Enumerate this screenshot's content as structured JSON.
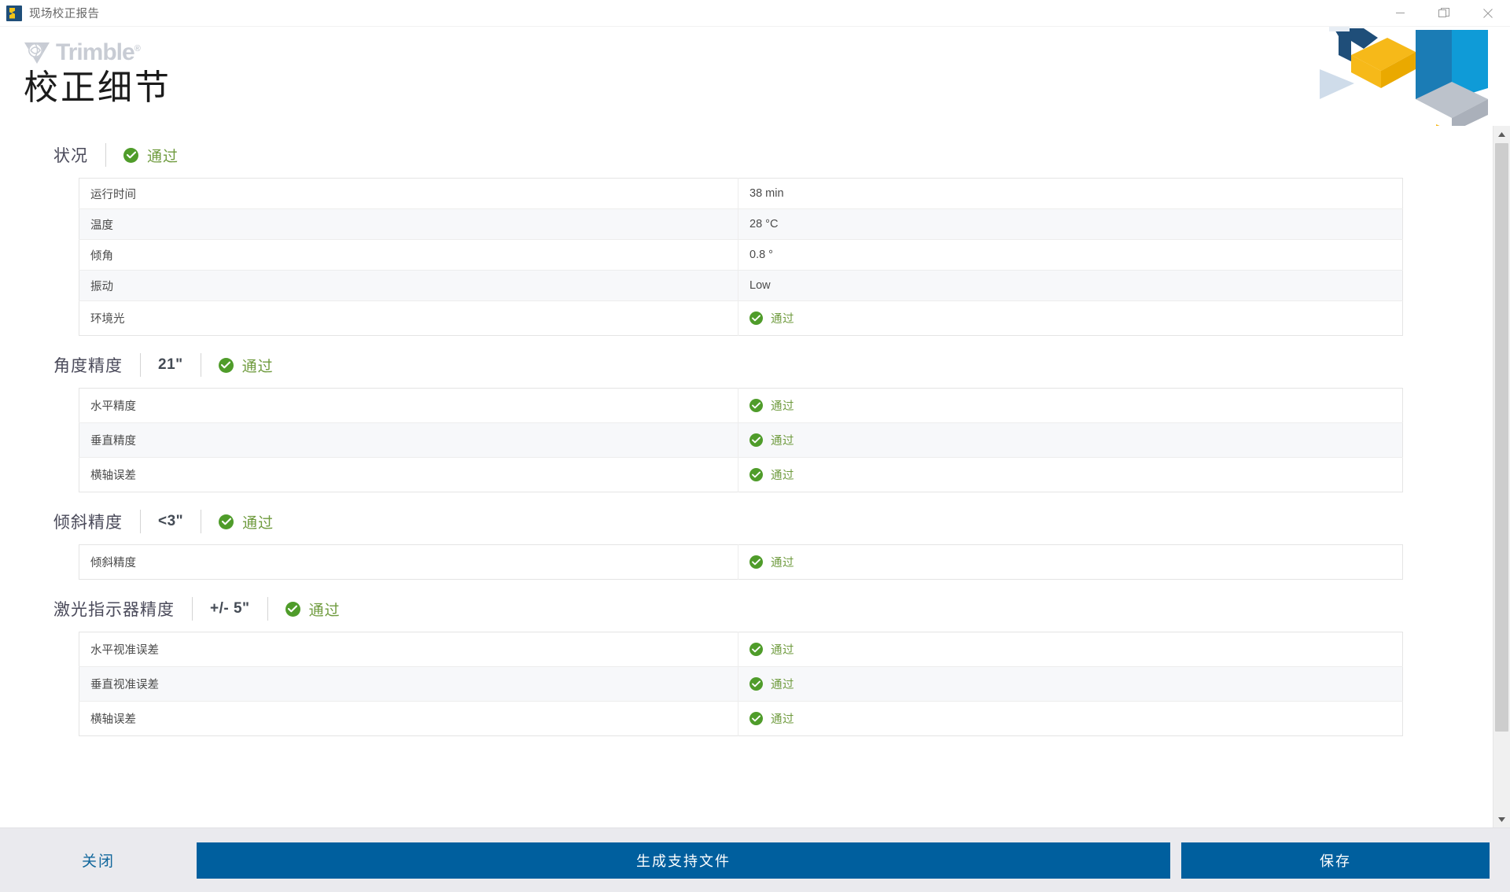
{
  "window": {
    "title": "现场校正报告",
    "icon": "trimble-app-icon",
    "controls": [
      {
        "name": "minimize-button",
        "glyph": "minimize-icon"
      },
      {
        "name": "restore-button",
        "glyph": "restore-icon"
      },
      {
        "name": "close-button",
        "glyph": "close-icon"
      }
    ]
  },
  "header": {
    "brand": "Trimble",
    "brand_mark": "trimble-globe-logo",
    "trademark": "®",
    "page_title": "校正细节",
    "decoration": "isometric-cubes-graphic",
    "colors": {
      "yellow": "#f6b919",
      "blue_dark": "#1f5c8b",
      "blue_mid": "#1b7cb5",
      "blue_light": "#0f9bd7",
      "gray": "#bcc2cb",
      "pale_blue": "#cfdcea"
    }
  },
  "status_label_pass": "通过",
  "sections": [
    {
      "title": "状况",
      "value": "",
      "status": "通过",
      "rows": [
        {
          "label": "运行时间",
          "value": "38 min",
          "status": null
        },
        {
          "label": "温度",
          "value": "28 °C",
          "status": null
        },
        {
          "label": "倾角",
          "value": "0.8 °",
          "status": null
        },
        {
          "label": "振动",
          "value": "Low",
          "status": null
        },
        {
          "label": "环境光",
          "value": "",
          "status": "通过"
        }
      ]
    },
    {
      "title": "角度精度",
      "value": "21\"",
      "status": "通过",
      "rows": [
        {
          "label": "水平精度",
          "value": "",
          "status": "通过"
        },
        {
          "label": "垂直精度",
          "value": "",
          "status": "通过"
        },
        {
          "label": "横轴误差",
          "value": "",
          "status": "通过"
        }
      ]
    },
    {
      "title": "倾斜精度",
      "value": "<3\"",
      "status": "通过",
      "rows": [
        {
          "label": "倾斜精度",
          "value": "",
          "status": "通过"
        }
      ]
    },
    {
      "title": "激光指示器精度",
      "value": "+/- 5\"",
      "status": "通过",
      "rows": [
        {
          "label": "水平视准误差",
          "value": "",
          "status": "通过"
        },
        {
          "label": "垂直视准误差",
          "value": "",
          "status": "通过"
        },
        {
          "label": "横轴误差",
          "value": "",
          "status": "通过"
        }
      ]
    }
  ],
  "footer": {
    "close_label": "关闭",
    "generate_label": "生成支持文件",
    "save_label": "保存",
    "primary_color": "#005f9e",
    "link_color": "#11679c"
  },
  "scrollbar": {
    "up_arrow": "chevron-up-icon",
    "down_arrow": "chevron-down-icon"
  },
  "accent_colors": {
    "pass_green": "#6f9b3e",
    "check_green": "#4f9c2a"
  }
}
